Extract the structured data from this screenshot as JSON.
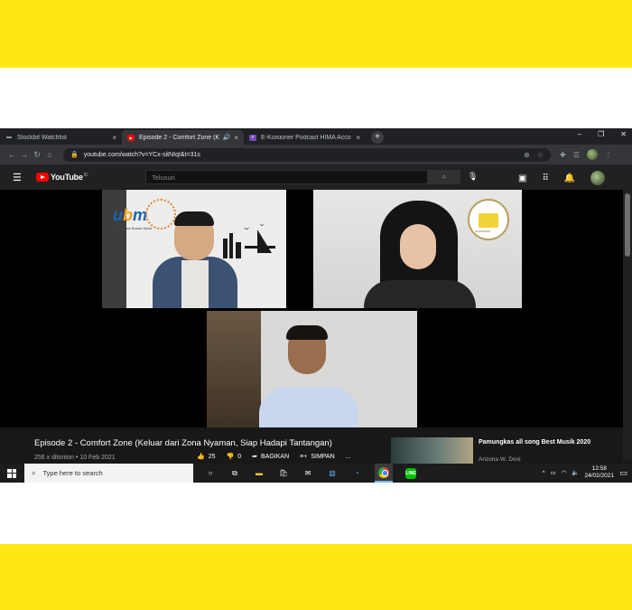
{
  "browser": {
    "tabs": [
      {
        "title": "Stockbit Watchlist",
        "favicon": "stockbit-icon",
        "close": "×"
      },
      {
        "title": "Episode 2 - Comfort Zone (K",
        "favicon": "youtube-icon",
        "close": "×",
        "speaker": "🔊"
      },
      {
        "title": "E-Kuisioner Podcast HIMA Acco",
        "favicon": "forms-icon",
        "close": "×"
      }
    ],
    "new_tab": "+",
    "window_controls": {
      "minimize": "–",
      "maximize": "❐",
      "close": "✕"
    },
    "nav": {
      "back": "←",
      "forward": "→",
      "reload": "↻",
      "home": "⌂"
    },
    "url": "youtube.com/watch?v=YCx-sitNIqI&t=31s"
  },
  "youtube": {
    "logo_text": "YouTube",
    "region": "ID",
    "search_placeholder": "Telusuri",
    "video_title": "Episode 2 - Comfort Zone (Keluar dari Zona Nyaman, Siap Hadapi Tantangan)",
    "views_date": "256 x ditonton • 10 Feb 2021",
    "likes": "25",
    "dislikes": "0",
    "share_label": "BAGIKAN",
    "save_label": "SIMPAN",
    "more": "...",
    "recommended": {
      "title": "Pamungkas all song Best Musik 2020",
      "channel": "Arizona W. Doni"
    }
  },
  "video_overlay": {
    "ubm_logo": "ubm",
    "ubm_tagline": "Universitas Bunda Mulia",
    "crest_text": "AKUNTANSI"
  },
  "taskbar": {
    "search_placeholder": "Type here to search",
    "time": "12:58",
    "date": "24/02/2021",
    "line_label": "LINE"
  },
  "colors": {
    "frame_yellow": "#ffe713",
    "yt_red": "#ff0000",
    "yt_dark": "#181818"
  }
}
